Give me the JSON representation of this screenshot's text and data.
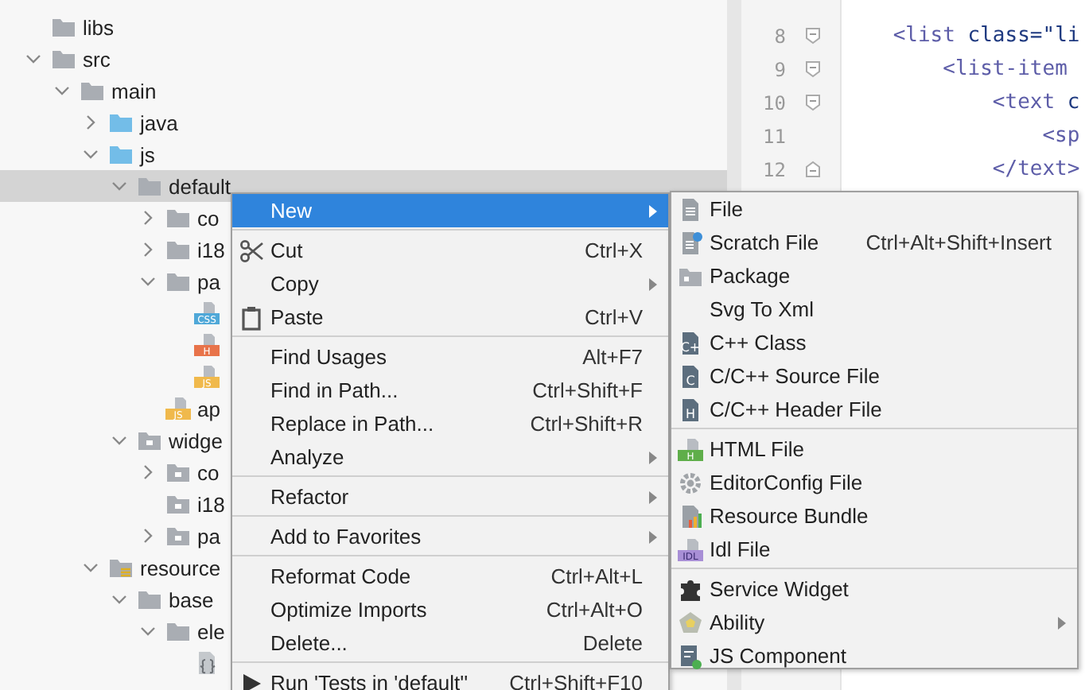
{
  "project_tree": [
    {
      "label": "libs",
      "kind": "folder",
      "selected": false
    },
    {
      "label": "src",
      "kind": "folder",
      "expanded": true,
      "selected": false,
      "children": [
        {
          "label": "main",
          "kind": "folder",
          "expanded": true,
          "selected": false,
          "children": [
            {
              "label": "java",
              "kind": "source-folder",
              "expanded": false,
              "selected": false
            },
            {
              "label": "js",
              "kind": "source-folder",
              "expanded": true,
              "selected": false,
              "children": [
                {
                  "label": "default",
                  "kind": "folder",
                  "expanded": true,
                  "selected": true,
                  "children": [
                    {
                      "label": "co",
                      "kind": "folder",
                      "expanded": false,
                      "selected": false
                    },
                    {
                      "label": "i18",
                      "kind": "folder",
                      "expanded": false,
                      "selected": false
                    },
                    {
                      "label": "pa",
                      "kind": "folder",
                      "expanded": true,
                      "selected": false,
                      "children": [
                        {
                          "kind": "badge-file",
                          "badge": "CSS",
                          "color": "#4fa8d8",
                          "selected": false
                        },
                        {
                          "kind": "badge-file",
                          "badge": "H",
                          "color": "#e8734a",
                          "selected": false
                        },
                        {
                          "kind": "badge-file",
                          "badge": "JS",
                          "color": "#f0b94c",
                          "selected": false
                        }
                      ]
                    },
                    {
                      "label": "ap",
                      "kind": "badge-file",
                      "badge": "JS",
                      "color": "#f0b94c",
                      "selected": false
                    }
                  ]
                },
                {
                  "label": "widge",
                  "kind": "module-folder",
                  "expanded": true,
                  "selected": false,
                  "children": [
                    {
                      "label": "co",
                      "kind": "module-folder",
                      "expanded": false,
                      "selected": false
                    },
                    {
                      "label": "i18",
                      "kind": "module-folder",
                      "selected": false
                    },
                    {
                      "label": "pa",
                      "kind": "module-folder",
                      "expanded": false,
                      "selected": false
                    }
                  ]
                }
              ]
            },
            {
              "label": "resource",
              "kind": "resources-folder",
              "expanded": true,
              "selected": false,
              "children": [
                {
                  "label": "base",
                  "kind": "folder",
                  "expanded": true,
                  "selected": false,
                  "children": [
                    {
                      "label": "ele",
                      "kind": "folder",
                      "expanded": true,
                      "selected": false,
                      "children": [
                        {
                          "kind": "json-file",
                          "selected": false
                        }
                      ]
                    }
                  ]
                }
              ]
            }
          ]
        }
      ]
    }
  ],
  "editor": {
    "lines": [
      {
        "number": "8",
        "kind": "fold-start",
        "tokens": [
          {
            "kind": "tag",
            "text": "    <list"
          },
          {
            "kind": "attr",
            "text": " class"
          },
          {
            "kind": "plain",
            "text": "="
          },
          {
            "kind": "string",
            "text": "\"li"
          }
        ]
      },
      {
        "number": "9",
        "kind": "fold-start",
        "tokens": [
          {
            "kind": "tag",
            "text": "        <list-item"
          }
        ]
      },
      {
        "number": "10",
        "kind": "fold-start",
        "tokens": [
          {
            "kind": "tag",
            "text": "            <text"
          },
          {
            "kind": "attr",
            "text": " c"
          }
        ]
      },
      {
        "number": "11",
        "kind": "plain",
        "tokens": [
          {
            "kind": "tag",
            "text": "                <sp"
          }
        ]
      },
      {
        "number": "12",
        "kind": "fold-end",
        "tokens": [
          {
            "kind": "tag",
            "text": "            </text>"
          }
        ]
      }
    ]
  },
  "context_menu": {
    "groups": [
      {
        "items": [
          {
            "label": "New",
            "submenu": true,
            "selected": true
          }
        ]
      },
      {
        "items": [
          {
            "label": "Cut",
            "kind": "scissors",
            "shortcut": "Ctrl+X",
            "submenu": false,
            "selected": false
          },
          {
            "label": "Copy",
            "submenu": true,
            "selected": false
          },
          {
            "label": "Paste",
            "kind": "clipboard",
            "shortcut": "Ctrl+V",
            "submenu": false,
            "selected": false
          }
        ]
      },
      {
        "items": [
          {
            "label": "Find Usages",
            "shortcut": "Alt+F7",
            "submenu": false,
            "selected": false
          },
          {
            "label": "Find in Path...",
            "shortcut": "Ctrl+Shift+F",
            "submenu": false,
            "selected": false
          },
          {
            "label": "Replace in Path...",
            "shortcut": "Ctrl+Shift+R",
            "submenu": false,
            "selected": false
          },
          {
            "label": "Analyze",
            "submenu": true,
            "selected": false
          }
        ]
      },
      {
        "items": [
          {
            "label": "Refactor",
            "submenu": true,
            "selected": false
          }
        ]
      },
      {
        "items": [
          {
            "label": "Add to Favorites",
            "submenu": true,
            "selected": false
          }
        ]
      },
      {
        "items": [
          {
            "label": "Reformat Code",
            "shortcut": "Ctrl+Alt+L",
            "submenu": false,
            "selected": false
          },
          {
            "label": "Optimize Imports",
            "shortcut": "Ctrl+Alt+O",
            "submenu": false,
            "selected": false
          },
          {
            "label": "Delete...",
            "shortcut": "Delete",
            "submenu": false,
            "selected": false
          }
        ]
      },
      {
        "items": [
          {
            "label": "Run 'Tests in 'default''",
            "kind": "play",
            "shortcut": "Ctrl+Shift+F10",
            "submenu": false,
            "selected": false
          }
        ]
      }
    ]
  },
  "new_submenu": {
    "groups": [
      {
        "items": [
          {
            "label": "File",
            "kind": "file",
            "submenu": false
          },
          {
            "label": "Scratch File",
            "kind": "scratch-file",
            "shortcut": "Ctrl+Alt+Shift+Insert",
            "submenu": false
          },
          {
            "label": "Package",
            "kind": "package",
            "submenu": false
          },
          {
            "label": "Svg To Xml",
            "submenu": false
          },
          {
            "label": "C++ Class",
            "kind": "c-file",
            "badge": "C+",
            "submenu": false
          },
          {
            "label": "C/C++ Source File",
            "kind": "c-file",
            "badge": "C",
            "submenu": false
          },
          {
            "label": "C/C++ Header File",
            "kind": "c-file",
            "badge": "H",
            "submenu": false
          }
        ]
      },
      {
        "items": [
          {
            "label": "HTML File",
            "kind": "badge-file",
            "badge": "H",
            "color": "#5fae4a",
            "submenu": false
          },
          {
            "label": "EditorConfig File",
            "kind": "gear",
            "submenu": false
          },
          {
            "label": "Resource Bundle",
            "kind": "bundle",
            "submenu": false
          },
          {
            "label": "Idl File",
            "kind": "badge-file",
            "badge": "IDL",
            "color": "#a88fd6",
            "submenu": false
          }
        ]
      },
      {
        "items": [
          {
            "label": "Service Widget",
            "kind": "puzzle",
            "submenu": false
          },
          {
            "label": "Ability",
            "kind": "pentagon",
            "submenu": true
          },
          {
            "label": "JS Component",
            "kind": "component",
            "submenu": false
          }
        ]
      }
    ]
  }
}
